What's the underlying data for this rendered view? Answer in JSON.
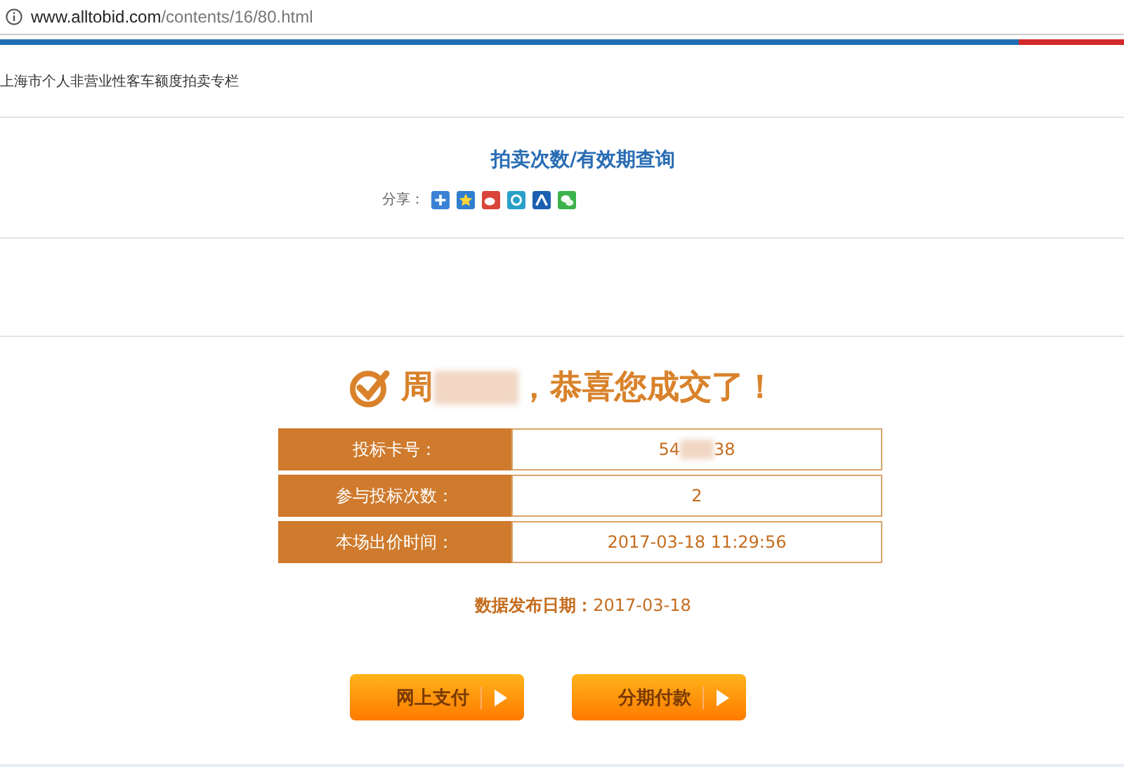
{
  "address_bar": {
    "domain": "www.alltobid.com",
    "path": "/contents/16/80.html"
  },
  "breadcrumb": "上海市个人非营业性客车额度拍卖专栏",
  "page_title": "拍卖次数/有效期查询",
  "share": {
    "label": "分享：",
    "services": [
      {
        "kind": "plus"
      },
      {
        "kind": "zone"
      },
      {
        "kind": "weibo"
      },
      {
        "kind": "pengyou"
      },
      {
        "kind": "renren"
      },
      {
        "kind": "wechat"
      }
    ]
  },
  "greeting": {
    "before": "周",
    "after": "，恭喜您成交了！"
  },
  "result_rows": [
    {
      "label": "投标卡号：",
      "value_before": "54",
      "value_after": "38",
      "redacted": true
    },
    {
      "label": "参与投标次数：",
      "value_before": "2",
      "redacted": false
    },
    {
      "label": "本场出价时间：",
      "value_before": "2017-03-18 11:29:56",
      "redacted": false
    }
  ],
  "publish_date": {
    "label": "数据发布日期：",
    "value": "2017-03-18"
  },
  "buttons": [
    "网上支付",
    "分期付款"
  ]
}
